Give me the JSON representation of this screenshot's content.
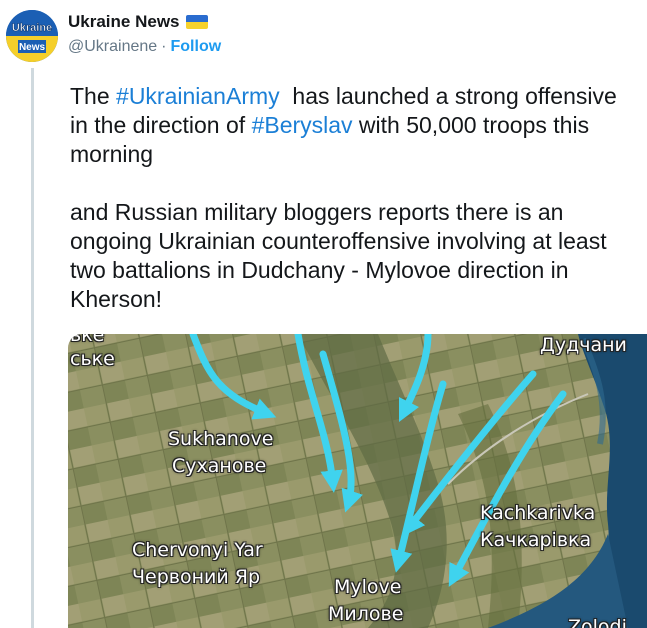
{
  "author": {
    "display_name": "Ukraine News",
    "handle": "@Ukrainene",
    "separator": "·",
    "follow_label": "Follow",
    "avatar_text_top": "Ukraine",
    "avatar_text_bottom": "News"
  },
  "tweet": {
    "p1_before": "The ",
    "hashtag1": "#UkrainianArmy",
    "p1_middle": "  has launched a strong offensive in the direction of ",
    "hashtag2": "#Beryslav",
    "p1_after": " with 50,000 troops this morning",
    "p2": "and Russian military bloggers reports there is an ongoing Ukrainian counteroffensive involving at least two battalions in Dudchany - Mylovoe direction in Kherson!"
  },
  "map": {
    "labels": {
      "top_left_partial_1": "ьке",
      "top_left_partial_2": "ське",
      "dudchany": "Дудчани",
      "sukhanove_en": "Sukhanove",
      "sukhanove_uk": "Суханове",
      "chervonyi_en": "Chervonyi Yar",
      "chervonyi_uk": "Червоний Яр",
      "kachkarivka_en": "Kachkarivka",
      "kachkarivka_uk": "Качкарівка",
      "mylove_en": "Mylove",
      "mylove_uk": "Милове",
      "zolota_partial": "Zolodi"
    }
  },
  "colors": {
    "link": "#1b7fd6",
    "arrow": "#3fd3ee",
    "water": "#1a4a6e"
  }
}
